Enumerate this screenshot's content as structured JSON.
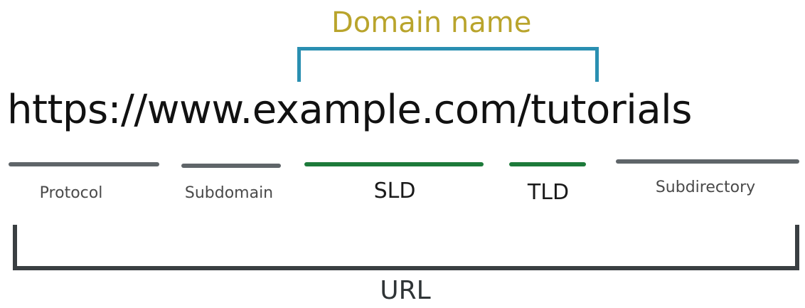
{
  "diagram": {
    "domain_label": "Domain name",
    "url": "https://www.example.com/tutorials",
    "url_label": "URL",
    "segments": [
      {
        "label": "Protocol",
        "color": "#5f6569"
      },
      {
        "label": "Subdomain",
        "color": "#5f6569"
      },
      {
        "label": "SLD",
        "color": "#1d7a3a"
      },
      {
        "label": "TLD",
        "color": "#1d7a3a"
      },
      {
        "label": "Subdirectory",
        "color": "#5f6569"
      }
    ]
  },
  "colors": {
    "domain_label": "#b9a42c",
    "domain_bracket": "#2a8fb1",
    "url_bracket": "#3a3f42"
  }
}
